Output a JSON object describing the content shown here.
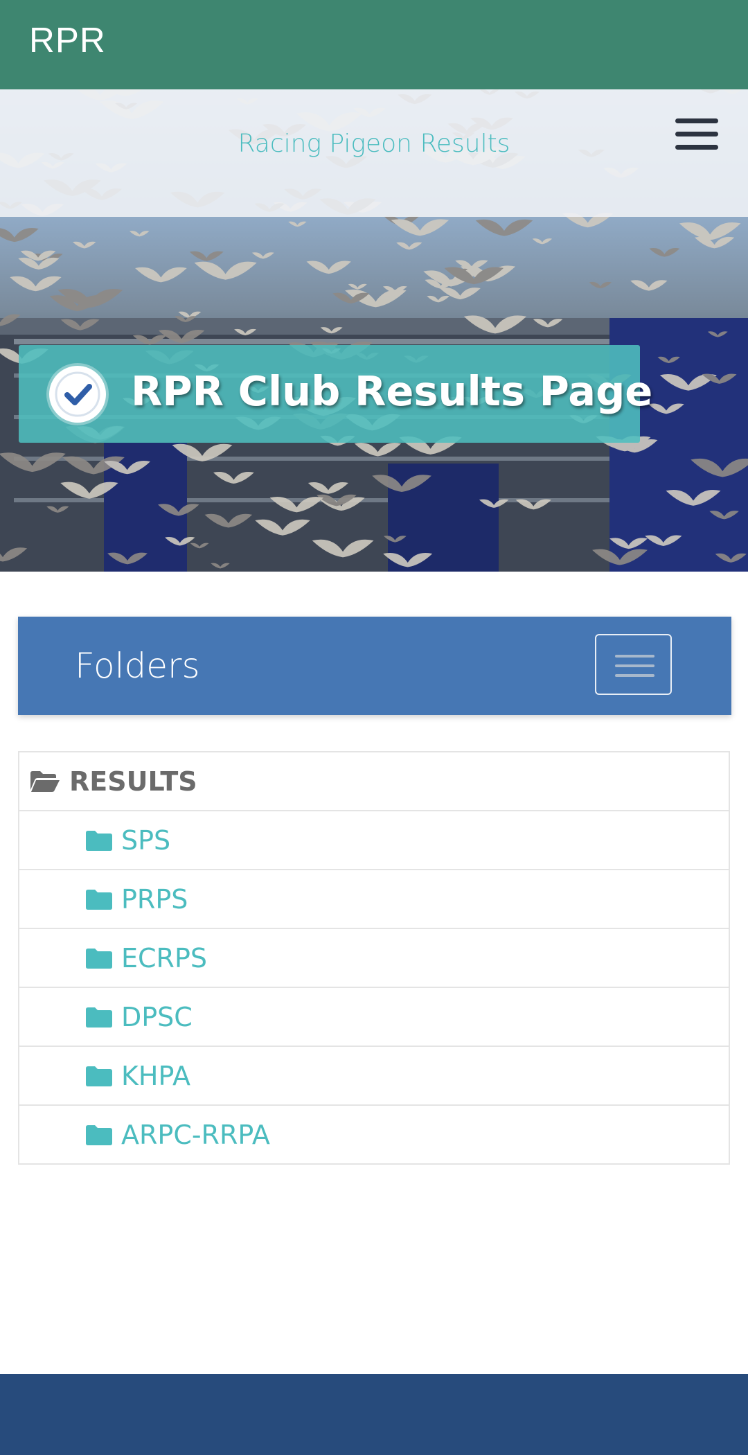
{
  "app_bar": {
    "title": "RPR"
  },
  "header": {
    "tagline": "Racing Pigeon Results"
  },
  "banner": {
    "title": "RPR Club Results Page"
  },
  "folders": {
    "heading": "Folders",
    "root_label": "RESULTS",
    "items": [
      {
        "label": "SPS"
      },
      {
        "label": "PRPS"
      },
      {
        "label": "ECRPS"
      },
      {
        "label": "DPSC"
      },
      {
        "label": "KHPA"
      },
      {
        "label": "ARPC-RRPA"
      }
    ]
  },
  "colors": {
    "app_bar": "#3e8670",
    "accent_teal": "#4bbcbf",
    "folders_header": "#4677b4",
    "footer": "#274b7c"
  }
}
